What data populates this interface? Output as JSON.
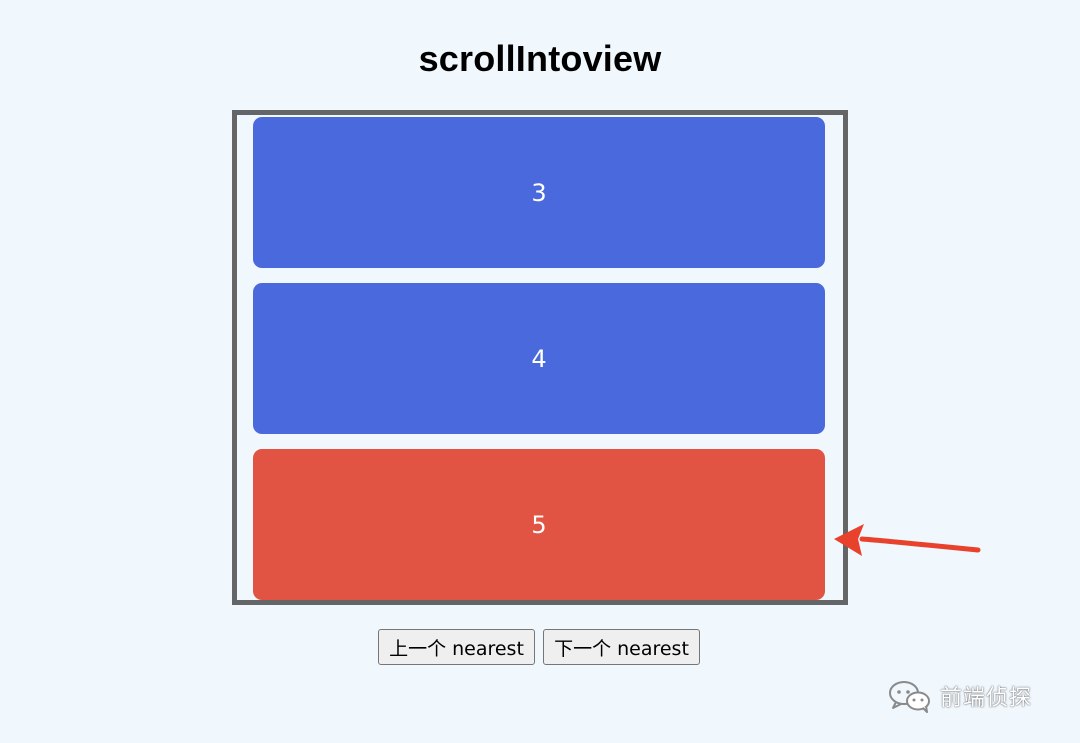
{
  "page": {
    "title": "scrollIntoview"
  },
  "scroll_container": {
    "cards": [
      {
        "label": "3",
        "color": "#4a69dc"
      },
      {
        "label": "4",
        "color": "#4a69dc"
      },
      {
        "label": "5",
        "color": "#e15342"
      }
    ]
  },
  "controls": {
    "prev_label": "上一个 nearest",
    "next_label": "下一个 nearest"
  },
  "annotation": {
    "arrow_color": "#e8412c",
    "icon": "arrow-left-icon"
  },
  "watermark": {
    "icon": "wechat-icon",
    "text": "前端侦探"
  },
  "colors": {
    "background": "#f0f7fd",
    "card_default": "#4a69dc",
    "card_active": "#e15342",
    "container_border": "#646566"
  }
}
